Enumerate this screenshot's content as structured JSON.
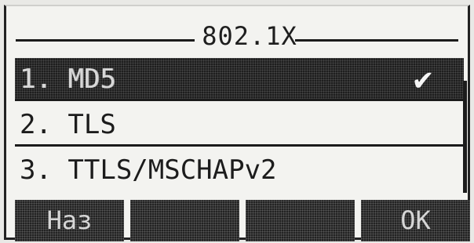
{
  "screen": {
    "title": "802.1X"
  },
  "menu": {
    "items": [
      {
        "label": "1. MD5",
        "selected": true,
        "checked": true
      },
      {
        "label": "2. TLS",
        "selected": false,
        "checked": false
      },
      {
        "label": "3. TTLS/MSCHAPv2",
        "selected": false,
        "checked": false
      }
    ],
    "check_glyph": "✔"
  },
  "softkeys": {
    "left": "Наз",
    "slot2": "",
    "slot3": "",
    "right": "OK"
  },
  "colors": {
    "lcd_background": "#f3f3f0",
    "pixel_dark": "#1e1e1e"
  }
}
